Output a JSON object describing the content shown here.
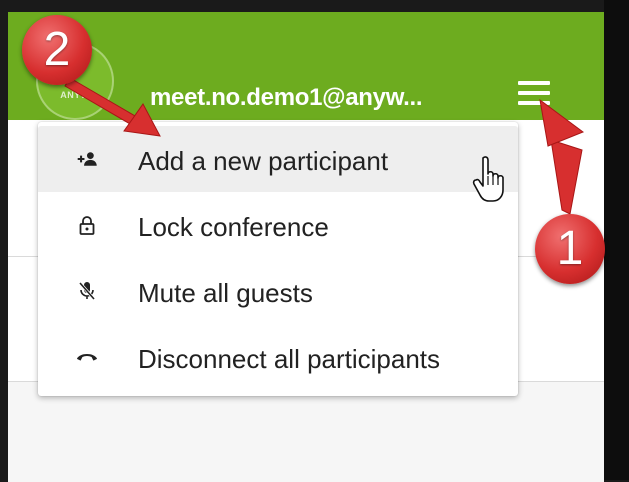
{
  "header": {
    "user_name": "meet.no.demo1@anyw...",
    "logo_text": "ANYW",
    "menu_icon": "hamburger-menu-icon"
  },
  "menu": {
    "items": [
      {
        "label": "Add a new participant",
        "icon": "add-participant-icon"
      },
      {
        "label": "Lock conference",
        "icon": "lock-icon"
      },
      {
        "label": "Mute all guests",
        "icon": "mic-off-icon"
      },
      {
        "label": "Disconnect all participants",
        "icon": "call-end-icon"
      }
    ]
  },
  "annotations": {
    "callout_1": "1",
    "callout_2": "2"
  },
  "colors": {
    "header_bg": "#6dac1f",
    "callout_red": "#d72f2f",
    "menu_bg": "#ffffff"
  }
}
